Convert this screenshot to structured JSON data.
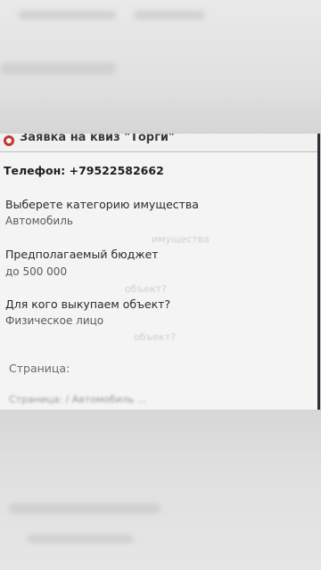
{
  "form": {
    "header_title": "Заявка на квиз \"Торги\"",
    "phone_label": "Телефон: +79522582662",
    "fields": [
      {
        "label": "Выберете категорию имущества",
        "value": "Автомобиль"
      },
      {
        "label": "Предполагаемый бюджет",
        "value": "до 500 000"
      },
      {
        "label": "Для кого выкупаем объект?",
        "value": "Физическое лицо"
      }
    ],
    "page_label": "Страница:",
    "page_url": "Страница: / Автомобиль ..."
  },
  "colors": {
    "card_bg": "#f4f4f4",
    "accent": "#c0392b",
    "frame": "#2b2f36"
  }
}
